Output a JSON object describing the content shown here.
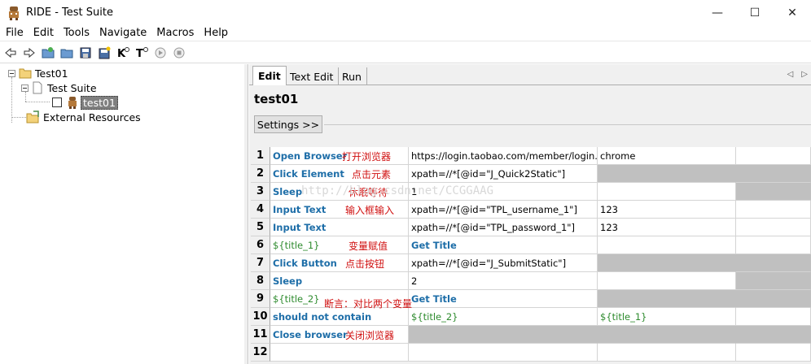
{
  "window": {
    "title": "RIDE - Test Suite",
    "minimize": "—",
    "maximize": "☐",
    "close": "✕"
  },
  "menu": [
    "File",
    "Edit",
    "Tools",
    "Navigate",
    "Macros",
    "Help"
  ],
  "toolbar": {
    "icons": [
      "back-icon",
      "forward-icon",
      "open-suite-icon",
      "open-dir-icon",
      "save-icon",
      "save-all-icon",
      "search-keywords-icon",
      "search-tests-icon",
      "run-icon",
      "stop-icon"
    ]
  },
  "tree": {
    "root": "Test01",
    "suite": "Test Suite",
    "test": "test01",
    "external": "External Resources"
  },
  "tabs": [
    "Edit",
    "Text Edit",
    "Run"
  ],
  "editor": {
    "test_name": "test01",
    "settings_label": "Settings >>"
  },
  "rows": [
    {
      "num": "1",
      "c1": "Open Browser",
      "c2": "https://login.taobao.com/member/login.jhtml",
      "c3": "chrome",
      "note": "打开浏览器"
    },
    {
      "num": "2",
      "c1": "Click Element",
      "c2": "xpath=//*[@id=\"J_Quick2Static\"]",
      "c3": "",
      "note": "点击元素"
    },
    {
      "num": "3",
      "c1": "Sleep",
      "c2": "1",
      "c3": "",
      "note": "休眠等待"
    },
    {
      "num": "4",
      "c1": "Input Text",
      "c2": "xpath=//*[@id=\"TPL_username_1\"]",
      "c3": "123",
      "note": "输入框输入"
    },
    {
      "num": "5",
      "c1": "Input Text",
      "c2": "xpath=//*[@id=\"TPL_password_1\"]",
      "c3": "123",
      "note": ""
    },
    {
      "num": "6",
      "c1": "${title_1}",
      "c2": "Get Title",
      "c3": "",
      "note": "变量赋值"
    },
    {
      "num": "7",
      "c1": "Click Button",
      "c2": "xpath=//*[@id=\"J_SubmitStatic\"]",
      "c3": "",
      "note": "点击按钮"
    },
    {
      "num": "8",
      "c1": "Sleep",
      "c2": "2",
      "c3": "",
      "note": ""
    },
    {
      "num": "9",
      "c1": "${title_2}",
      "c2": "Get Title",
      "c3": "",
      "note": ""
    },
    {
      "num": "10",
      "c1": "should not contain",
      "c2": "${title_2}",
      "c3": "${title_1}",
      "note": "断言：对比两个变量"
    },
    {
      "num": "11",
      "c1": "Close browser",
      "c2": "",
      "c3": "",
      "note": "关闭浏览器"
    },
    {
      "num": "12",
      "c1": "",
      "c2": "",
      "c3": "",
      "note": ""
    }
  ],
  "watermark": "http://blog.csdn.net/CCGGAAG"
}
